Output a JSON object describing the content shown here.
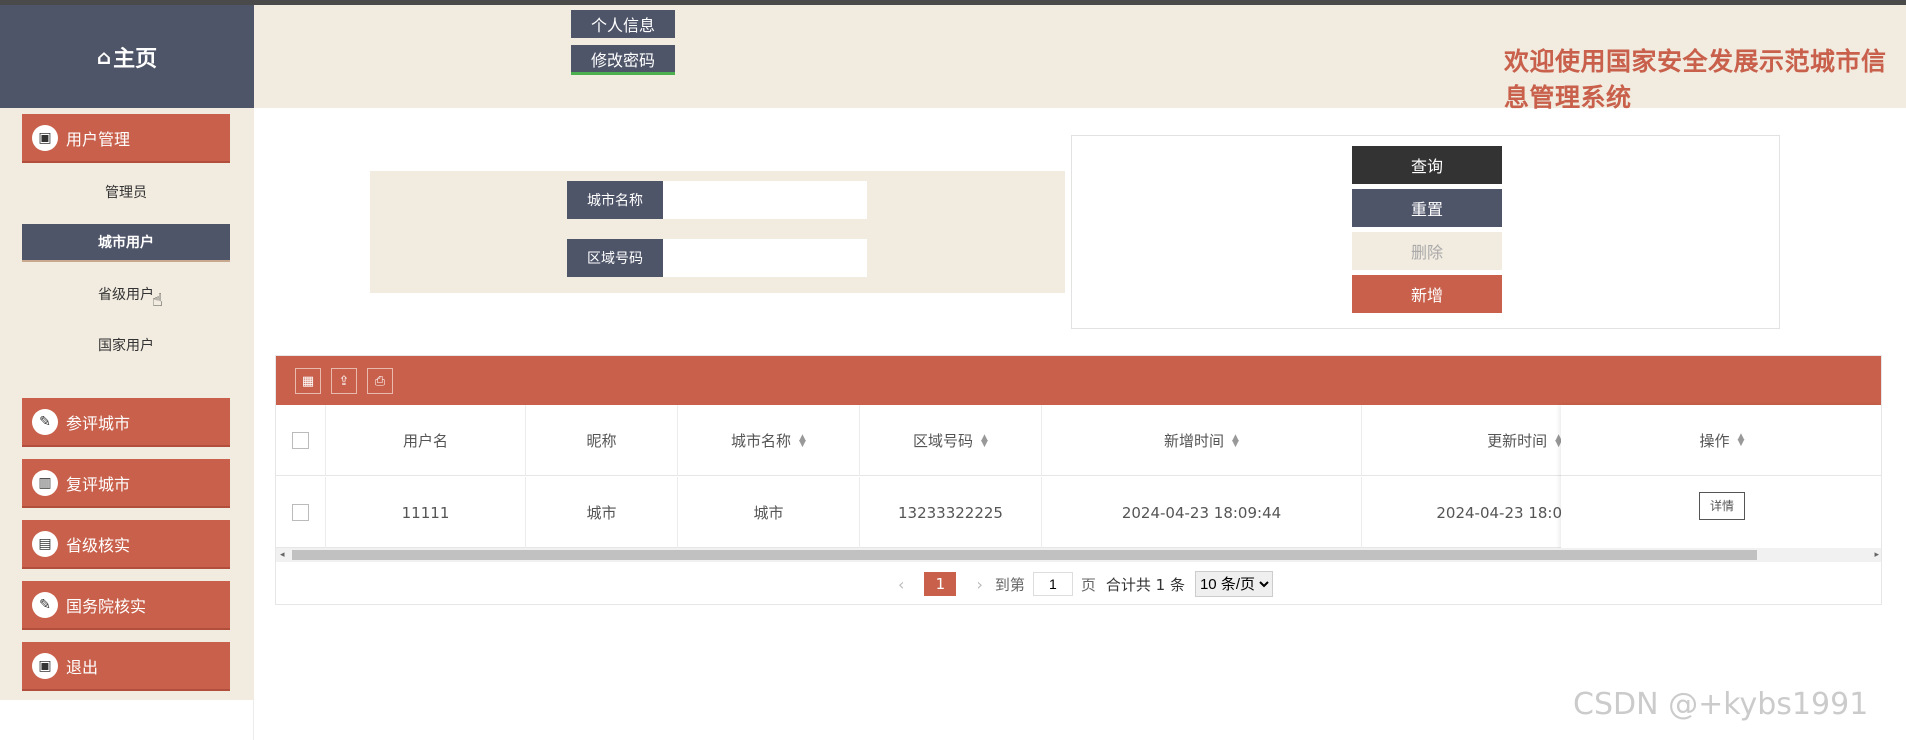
{
  "header": {
    "home_label": "主页",
    "home_icon": "home-icon",
    "profile_button": "个人信息",
    "password_button": "修改密码",
    "site_title": "欢迎使用国家安全发展示范城市信息管理系统"
  },
  "sidebar": {
    "user_mgmt": "用户管理",
    "sub_items": [
      "管理员",
      "城市用户",
      "省级用户",
      "国家用户"
    ],
    "active_sub": "城市用户",
    "menus": [
      "参评城市",
      "复评城市",
      "省级核实",
      "国务院核实",
      "退出"
    ]
  },
  "search": {
    "city_name_label": "城市名称",
    "city_name_value": "",
    "area_code_label": "区域号码",
    "area_code_value": ""
  },
  "actions": {
    "query": "查询",
    "reset": "重置",
    "delete": "删除",
    "add": "新增"
  },
  "table": {
    "columns": [
      "用户名",
      "昵称",
      "城市名称",
      "区域号码",
      "新增时间",
      "更新时间",
      "操作"
    ],
    "rows": [
      {
        "username": "11111",
        "nickname": "城市",
        "city": "城市",
        "area_code": "13233322225",
        "created": "2024-04-23 18:09:44",
        "updated": "2024-04-23 18:0",
        "detail": "详情"
      }
    ]
  },
  "pager": {
    "current_page": "1",
    "goto_prefix": "到第",
    "goto_value": "1",
    "goto_suffix": "页",
    "total": "合计共 1 条",
    "page_size": "10 条/页"
  },
  "watermark": "CSDN @+kybs1991",
  "colors": {
    "accent": "#c8604b",
    "dark": "#4f5569",
    "cream": "#f1ebe0"
  }
}
